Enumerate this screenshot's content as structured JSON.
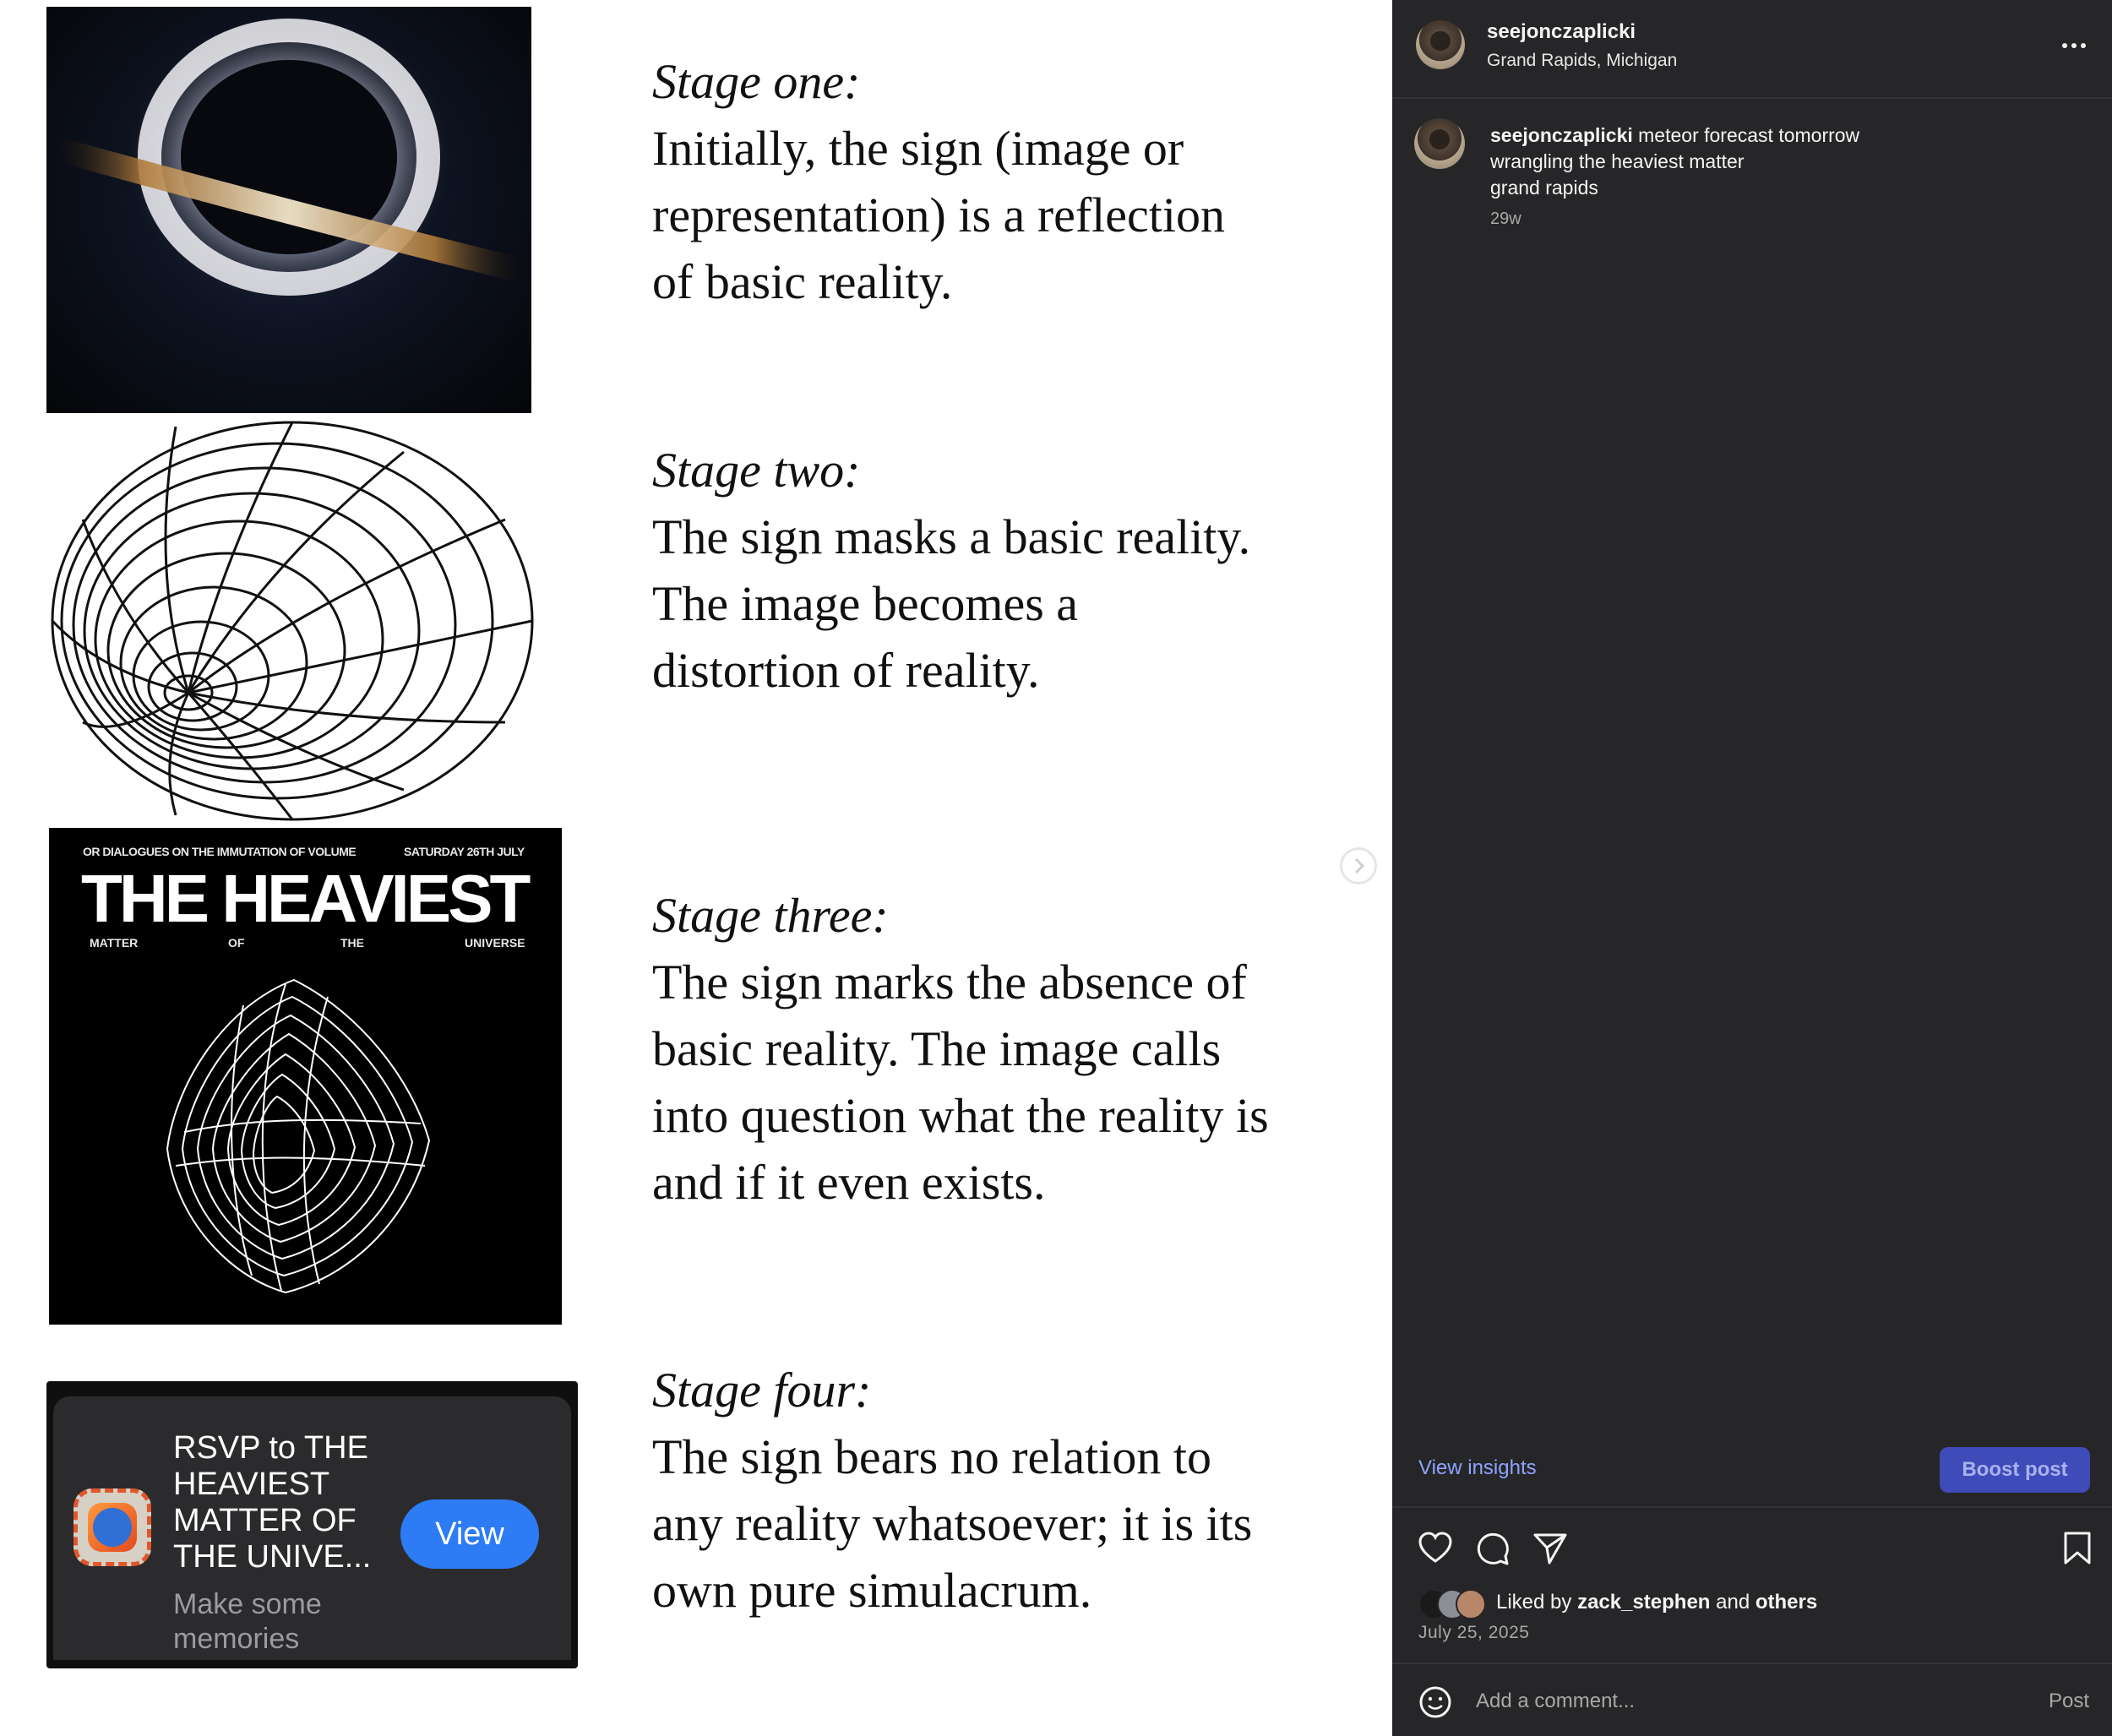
{
  "media": {
    "stages": [
      {
        "title": "Stage one:",
        "body": "Initially, the sign (image or\nrepresentation) is a reflection\nof basic reality."
      },
      {
        "title": "Stage two:",
        "body": " The sign masks a basic reality.\nThe image becomes a\ndistortion of reality."
      },
      {
        "title": "Stage three:",
        "body": "The sign marks the absence of\nbasic reality. The image calls\ninto question what the reality is\nand if it even exists."
      },
      {
        "title": "Stage four:",
        "body": "The sign bears no relation to\nany reality whatsoever; it is its\nown pure simulacrum."
      }
    ],
    "poster": {
      "top_left": "OR DIALOGUES ON THE IMMUTATION OF VOLUME",
      "top_right": "SATURDAY 26TH JULY",
      "title": "THE HEAVIEST",
      "sub": [
        "MATTER",
        "OF",
        "THE",
        "UNIVERSE"
      ]
    },
    "rsvp": {
      "title": "RSVP to THE HEAVIEST MATTER OF THE UNIVE...",
      "subtitle": "Make some memories",
      "button": "View"
    },
    "next_icon": "chevron-right-icon"
  },
  "header": {
    "username": "seejonczaplicki",
    "location": "Grand Rapids, Michigan",
    "more_icon": "more-horizontal-icon"
  },
  "caption": {
    "username": "seejonczaplicki",
    "first_line": "meteor forecast tomorrow",
    "lines": [
      "wrangling the heaviest matter",
      "grand rapids"
    ],
    "time_ago": "29w"
  },
  "insights_label": "View insights",
  "boost_label": "Boost post",
  "actions": [
    "heart-icon",
    "comment-icon",
    "share-icon",
    "bookmark-icon"
  ],
  "likes": {
    "prefix": "Liked by",
    "user": "zack_stephen",
    "and": "and",
    "others": "others"
  },
  "date": "July 25, 2025",
  "comment": {
    "placeholder": "Add a comment...",
    "post_label": "Post",
    "emoji_icon": "emoji-icon"
  },
  "colors": {
    "panel_bg": "#262628",
    "link": "#8fa3ff",
    "boost_bg": "#3e4bb8",
    "view_button": "#2d7cf6"
  }
}
